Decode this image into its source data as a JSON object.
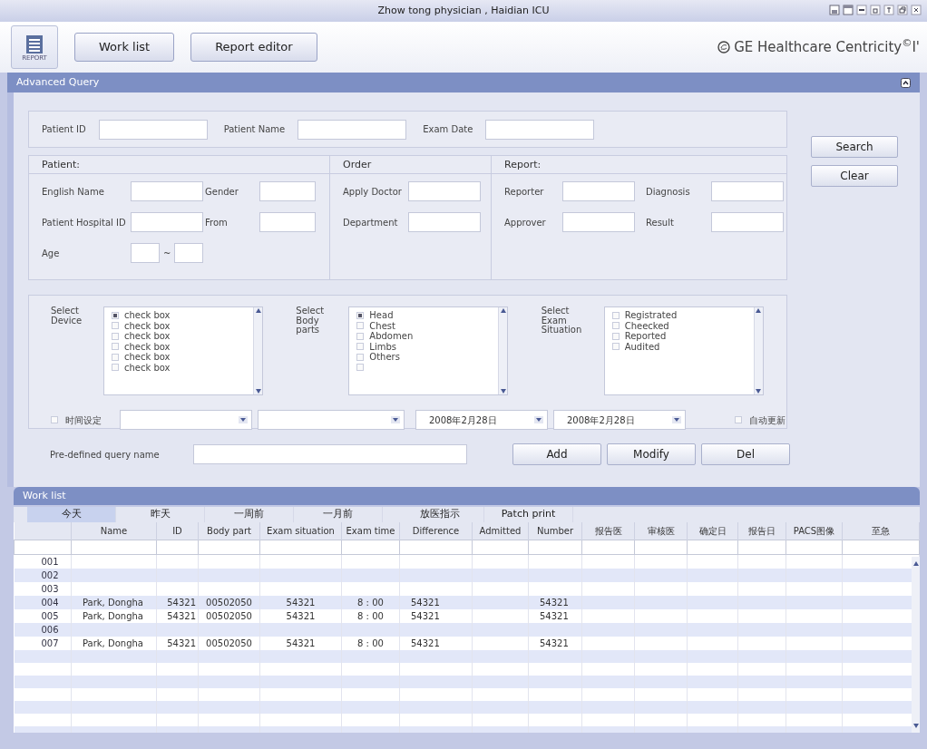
{
  "window": {
    "title": "Zhow tong physician , Haidian ICU"
  },
  "toolbar": {
    "app_icon_label": "REPORT",
    "buttons": [
      {
        "label": "Work list"
      },
      {
        "label": "Report editor"
      }
    ],
    "brand": "GE Healthcare Centricity$^{©}$I'"
  },
  "advanced_query": {
    "title": "Advanced Query",
    "top_fields": [
      {
        "label": "Patient ID"
      },
      {
        "label": "Patient Name"
      },
      {
        "label": "Exam Date"
      }
    ],
    "groups": [
      {
        "title": "Patient:",
        "fields": [
          {
            "label": "English Name",
            "kind": "text"
          },
          {
            "label": "Gender",
            "kind": "text"
          },
          {
            "label": "Patient Hospital ID",
            "kind": "text"
          },
          {
            "label": "From",
            "kind": "text"
          },
          {
            "label": "Age",
            "kind": "range",
            "separator": "~"
          }
        ]
      },
      {
        "title": "Order",
        "fields": [
          {
            "label": "Apply Doctor",
            "kind": "text"
          },
          {
            "label": "Department",
            "kind": "text"
          }
        ]
      },
      {
        "title": "Report:",
        "fields": [
          {
            "label": "Reporter",
            "kind": "text"
          },
          {
            "label": "Diagnosis",
            "kind": "text"
          },
          {
            "label": "Approver",
            "kind": "text"
          },
          {
            "label": "Result",
            "kind": "text"
          }
        ]
      }
    ],
    "side_buttons": [
      {
        "label": "Search"
      },
      {
        "label": "Clear"
      }
    ],
    "selectors": [
      {
        "label": "Select Device",
        "items": [
          {
            "label": "check  box",
            "checked": true
          },
          {
            "label": "check  box",
            "checked": false
          },
          {
            "label": "check  box",
            "checked": false
          },
          {
            "label": "check  box",
            "checked": false
          },
          {
            "label": "check  box",
            "checked": false
          },
          {
            "label": "check  box",
            "checked": false
          }
        ]
      },
      {
        "label": "Select Body parts",
        "items": [
          {
            "label": "Head",
            "checked": true
          },
          {
            "label": "Chest",
            "checked": false
          },
          {
            "label": "Abdomen",
            "checked": false
          },
          {
            "label": "Limbs",
            "checked": false
          },
          {
            "label": "Others",
            "checked": false
          },
          {
            "checked": false
          }
        ]
      },
      {
        "label": "Select Exam Situation",
        "items": [
          {
            "label": "Registrated",
            "checked": false
          },
          {
            "label": "Cheecked",
            "checked": false
          },
          {
            "label": "Reported",
            "checked": false
          },
          {
            "label": "Audited",
            "checked": false
          }
        ]
      }
    ],
    "time_setting": {
      "label": "时间设定",
      "checked": false
    },
    "dropdowns": [
      {
        "kind": "empty"
      },
      {
        "kind": "empty"
      },
      {
        "kind": "date",
        "value": "2008年2月28日"
      },
      {
        "kind": "date",
        "value": "2008年2月28日"
      }
    ],
    "auto_update": {
      "label": "自动更新",
      "checked": false
    },
    "predefined_query": {
      "label": "Pre-defined query name"
    },
    "query_buttons": [
      {
        "label": "Add"
      },
      {
        "label": "Modify"
      },
      {
        "label": "Del"
      }
    ]
  },
  "work_list": {
    "title": "Work list",
    "tabs": [
      {
        "label": "今天",
        "selected": true
      },
      {
        "label": "昨天",
        "selected": false
      },
      {
        "label": "一周前",
        "selected": false
      },
      {
        "label": "一月前",
        "selected": false
      },
      {
        "label": "放医指示",
        "selected": false
      },
      {
        "label": "Patch print",
        "selected": false
      }
    ],
    "columns": [
      "Name",
      "ID",
      "Body part",
      "Exam situation",
      "Exam time",
      "Difference",
      "Admitted",
      "Number",
      "报告医",
      "审核医",
      "确定日",
      "报告日",
      "PACS图像",
      "至急"
    ],
    "rows": [
      {
        "no": "001"
      },
      {
        "no": "002"
      },
      {
        "no": "003"
      },
      {
        "no": "004",
        "cells": [
          "Park, Dongha",
          "54321",
          "00502050",
          "54321",
          "8 : 00",
          "54321",
          "",
          "54321"
        ]
      },
      {
        "no": "005",
        "cells": [
          "Park, Dongha",
          "54321",
          "00502050",
          "54321",
          "8 : 00",
          "54321",
          "",
          "54321"
        ]
      },
      {
        "no": "006"
      },
      {
        "no": "007",
        "cells": [
          "Park, Dongha",
          "54321",
          "00502050",
          "54321",
          "8 : 00",
          "54321",
          "",
          "54321"
        ]
      }
    ]
  }
}
